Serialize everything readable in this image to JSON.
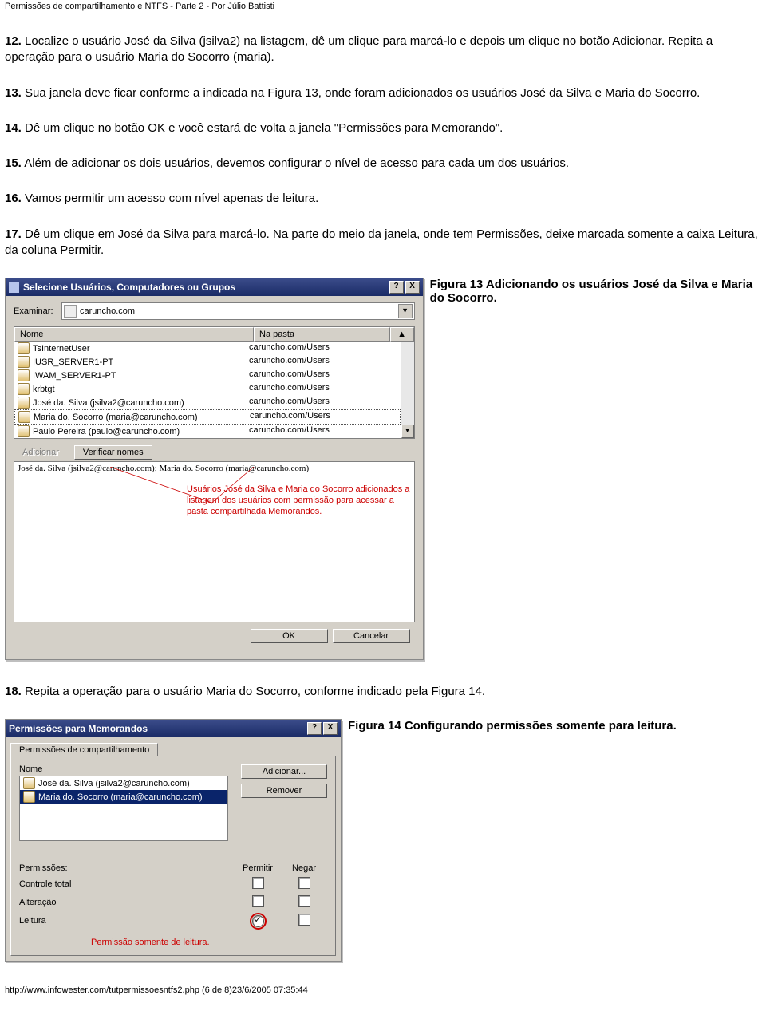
{
  "header": "Permissões de compartilhamento e NTFS - Parte 2 - Por Júlio Battisti",
  "steps": {
    "s12": {
      "n": "12.",
      "t": " Localize o usuário José da Silva (jsilva2) na listagem, dê um clique para marcá-lo e depois um clique no botão Adicionar. Repita a operação para o usuário Maria do Socorro (maria)."
    },
    "s13": {
      "n": "13.",
      "t": " Sua janela deve ficar conforme a indicada na Figura 13, onde foram adicionados os usuários José da Silva e Maria do Socorro."
    },
    "s14": {
      "n": "14.",
      "t": " Dê um clique no botão OK e você estará de volta a janela \"Permissões para Memorando\"."
    },
    "s15": {
      "n": "15.",
      "t": " Além de adicionar os dois usuários, devemos configurar o nível de acesso para cada um dos usuários."
    },
    "s16": {
      "n": "16.",
      "t": " Vamos permitir um acesso com nível apenas de leitura."
    },
    "s17": {
      "n": "17.",
      "t": " Dê um clique em José da Silva para marcá-lo. Na parte do meio da janela, onde tem Permissões, deixe marcada somente a caixa Leitura, da coluna Permitir."
    },
    "s18": {
      "n": "18.",
      "t": " Repita a operação para o usuário Maria do Socorro, conforme indicado pela Figura 14."
    }
  },
  "fig13_caption": "Figura 13 Adicionando os usuários José da Silva e Maria do Socorro.",
  "fig14_caption": "Figura 14 Configurando permissões somente para leitura.",
  "dlg1": {
    "title": "Selecione Usuários, Computadores ou Grupos",
    "help": "?",
    "close": "X",
    "examinar_lbl": "Examinar:",
    "examinar_val": "caruncho.com",
    "col_nome": "Nome",
    "col_napasta": "Na pasta",
    "scroll_up": "▲",
    "items": [
      {
        "name": "TsInternetUser",
        "path": "caruncho.com/Users"
      },
      {
        "name": "IUSR_SERVER1-PT",
        "path": "caruncho.com/Users"
      },
      {
        "name": "IWAM_SERVER1-PT",
        "path": "caruncho.com/Users"
      },
      {
        "name": "krbtgt",
        "path": "caruncho.com/Users"
      },
      {
        "name": "José da. Silva (jsilva2@caruncho.com)",
        "path": "caruncho.com/Users"
      },
      {
        "name": "Maria do. Socorro (maria@caruncho.com)",
        "path": "caruncho.com/Users"
      },
      {
        "name": "Paulo Pereira (paulo@caruncho.com)",
        "path": "caruncho.com/Users"
      }
    ],
    "scroll_down": "▼",
    "btn_adicionar": "Adicionar",
    "btn_verificar": "Verificar nomes",
    "selected_text": "José da. Silva (jsilva2@caruncho.com); Maria do. Socorro (maria@caruncho.com)",
    "annotation": "Usuários José da Silva e Maria do Socorro adicionados a listagem dos usuários com permissão para acessar a pasta compartilhada Memorandos.",
    "btn_ok": "OK",
    "btn_cancel": "Cancelar"
  },
  "dlg2": {
    "title": "Permissões para Memorandos",
    "help": "?",
    "close": "X",
    "tab": "Permissões de compartilhamento",
    "col_nome": "Nome",
    "btn_add": "Adicionar...",
    "btn_rem": "Remover",
    "rows": [
      {
        "name": "José da. Silva (jsilva2@caruncho.com)",
        "sel": false
      },
      {
        "name": "Maria do. Socorro (maria@caruncho.com)",
        "sel": true
      }
    ],
    "perm_lbl": "Permissões:",
    "perm_permitir": "Permitir",
    "perm_negar": "Negar",
    "perms": [
      {
        "name": "Controle total",
        "permit": false,
        "deny": false
      },
      {
        "name": "Alteração",
        "permit": false,
        "deny": false
      },
      {
        "name": "Leitura",
        "permit": true,
        "deny": false,
        "ring": true
      }
    ],
    "annotation": "Permissão somente de leitura."
  },
  "footer": "http://www.infowester.com/tutpermissoesntfs2.php   (6 de 8)23/6/2005 07:35:44"
}
